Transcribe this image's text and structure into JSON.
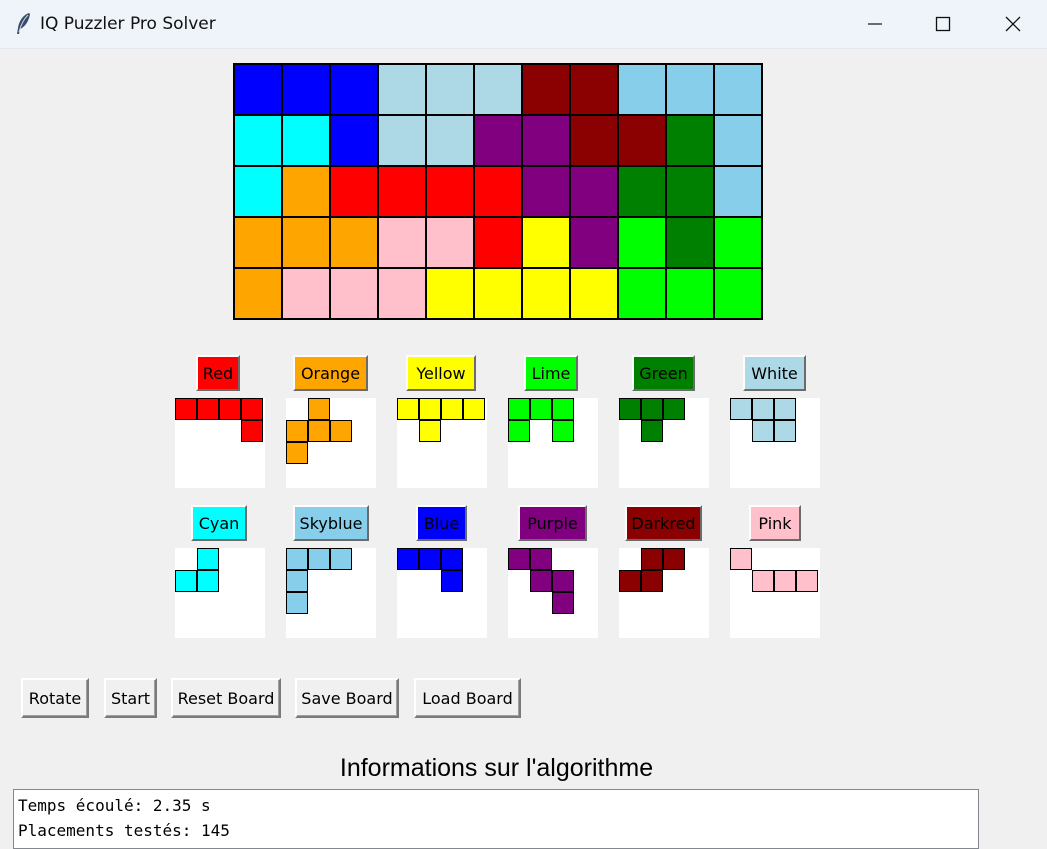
{
  "window": {
    "title": "IQ Puzzler Pro Solver",
    "controls": [
      "minimize",
      "maximize",
      "close"
    ]
  },
  "colors": {
    "R": "#ff0000",
    "O": "#ffa500",
    "Y": "#ffff00",
    "L": "#00ff00",
    "G": "#008000",
    "W": "#add8e6",
    "C": "#00ffff",
    "S": "#87ceeb",
    "B": "#0000ff",
    "P": "#800080",
    "D": "#8b0000",
    "K": "#ffc0cb"
  },
  "board": {
    "rows": [
      [
        "B",
        "B",
        "B",
        "W",
        "W",
        "W",
        "D",
        "D",
        "S",
        "S",
        "S"
      ],
      [
        "C",
        "C",
        "B",
        "W",
        "W",
        "P",
        "P",
        "D",
        "D",
        "G",
        "S"
      ],
      [
        "C",
        "O",
        "R",
        "R",
        "R",
        "R",
        "P",
        "P",
        "G",
        "G",
        "S"
      ],
      [
        "O",
        "O",
        "O",
        "K",
        "K",
        "R",
        "Y",
        "P",
        "L",
        "G",
        "L"
      ],
      [
        "O",
        "K",
        "K",
        "K",
        "Y",
        "Y",
        "Y",
        "Y",
        "L",
        "L",
        "L"
      ]
    ]
  },
  "pieces": [
    {
      "label": "Red",
      "color": "R",
      "cells": [
        [
          0,
          0
        ],
        [
          0,
          1
        ],
        [
          0,
          2
        ],
        [
          0,
          3
        ],
        [
          1,
          3
        ]
      ]
    },
    {
      "label": "Orange",
      "color": "O",
      "cells": [
        [
          0,
          1
        ],
        [
          1,
          1
        ],
        [
          1,
          2
        ],
        [
          1,
          0
        ],
        [
          2,
          0
        ]
      ]
    },
    {
      "label": "Yellow",
      "color": "Y",
      "cells": [
        [
          0,
          0
        ],
        [
          0,
          1
        ],
        [
          0,
          2
        ],
        [
          0,
          3
        ],
        [
          1,
          1
        ]
      ]
    },
    {
      "label": "Lime",
      "color": "L",
      "cells": [
        [
          0,
          0
        ],
        [
          0,
          1
        ],
        [
          0,
          2
        ],
        [
          1,
          0
        ],
        [
          1,
          2
        ]
      ]
    },
    {
      "label": "Green",
      "color": "G",
      "cells": [
        [
          0,
          0
        ],
        [
          0,
          1
        ],
        [
          0,
          2
        ],
        [
          1,
          1
        ]
      ]
    },
    {
      "label": "White",
      "color": "W",
      "cells": [
        [
          0,
          0
        ],
        [
          0,
          1
        ],
        [
          0,
          2
        ],
        [
          1,
          1
        ],
        [
          1,
          2
        ]
      ]
    },
    {
      "label": "Cyan",
      "color": "C",
      "cells": [
        [
          0,
          1
        ],
        [
          1,
          0
        ],
        [
          1,
          1
        ]
      ]
    },
    {
      "label": "Skyblue",
      "color": "S",
      "cells": [
        [
          0,
          0
        ],
        [
          0,
          1
        ],
        [
          0,
          2
        ],
        [
          1,
          0
        ],
        [
          2,
          0
        ]
      ]
    },
    {
      "label": "Blue",
      "color": "B",
      "cells": [
        [
          0,
          0
        ],
        [
          0,
          1
        ],
        [
          0,
          2
        ],
        [
          1,
          2
        ]
      ]
    },
    {
      "label": "Purple",
      "color": "P",
      "cells": [
        [
          0,
          0
        ],
        [
          0,
          1
        ],
        [
          1,
          1
        ],
        [
          1,
          2
        ],
        [
          2,
          2
        ]
      ]
    },
    {
      "label": "Darkred",
      "color": "D",
      "cells": [
        [
          0,
          1
        ],
        [
          0,
          2
        ],
        [
          1,
          0
        ],
        [
          1,
          1
        ]
      ]
    },
    {
      "label": "Pink",
      "color": "K",
      "cells": [
        [
          0,
          0
        ],
        [
          1,
          1
        ],
        [
          1,
          2
        ],
        [
          1,
          3
        ]
      ]
    }
  ],
  "controls": {
    "rotate": "Rotate",
    "start": "Start",
    "reset": "Reset Board",
    "save": "Save Board",
    "load": "Load Board"
  },
  "info": {
    "title": "Informations sur l'algorithme",
    "lines": [
      "Temps écoulé: 2.35 s",
      "Placements testés: 145"
    ]
  }
}
